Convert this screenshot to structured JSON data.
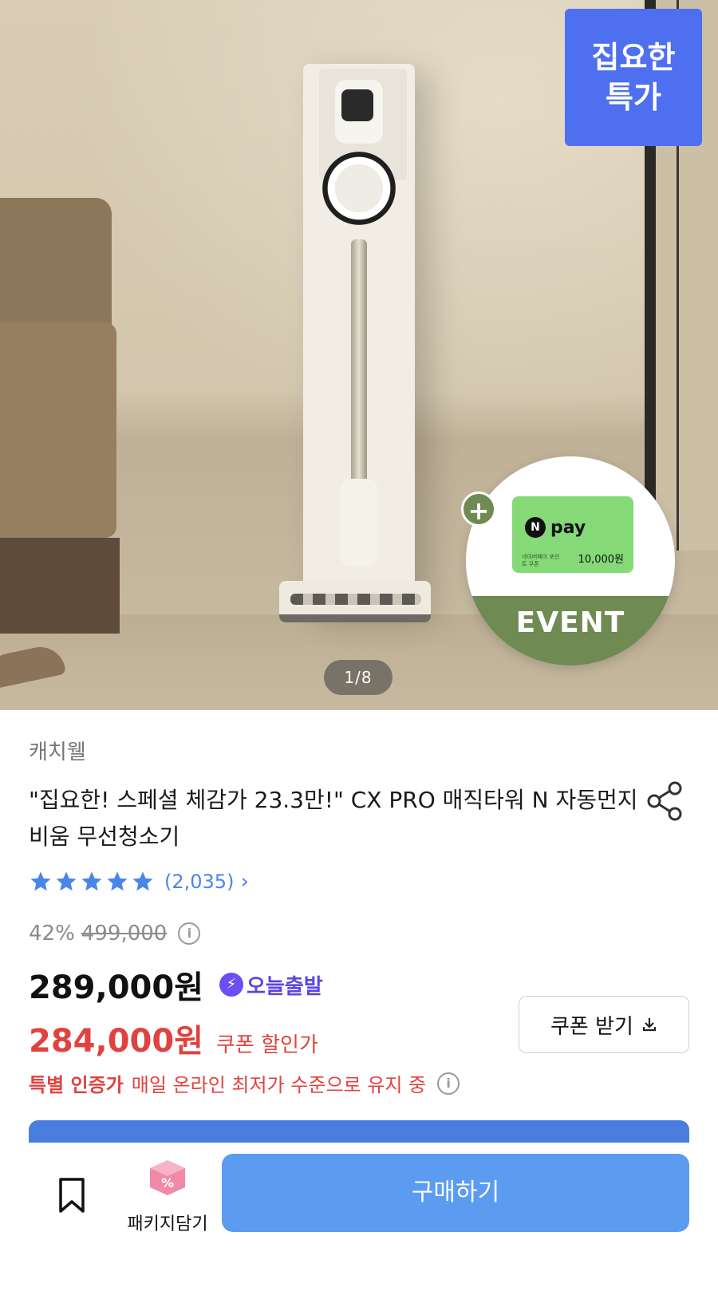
{
  "hero": {
    "deal_badge_line1": "집요한",
    "deal_badge_line2": "특가",
    "event_plus": "+",
    "npay_logo": "N",
    "npay_word": "pay",
    "npay_small": "네이버페이 포인트 쿠폰",
    "npay_amount": "10,000원",
    "event_label": "EVENT",
    "page_counter": "1/8"
  },
  "product": {
    "brand": "캐치웰",
    "title": "\"집요한! 스페셜 체감가 23.3만!\" CX PRO 매직타워 N 자동먼지비움 무선청소기",
    "rating_stars": 5,
    "rating_count": "(2,035)",
    "rating_arrow": "›",
    "discount_rate": "42%",
    "original_price": "499,000",
    "price": "289,000원",
    "delivery_icon": "⚡",
    "delivery_label": "오늘출발",
    "coupon_price": "284,000원",
    "coupon_label": "쿠폰 할인가",
    "coupon_button": "쿠폰 받기",
    "cert_strong": "특별 인증가",
    "cert_text": "매일 온라인 최저가 수준으로 유지 중",
    "info_glyph": "i"
  },
  "bottom_bar": {
    "package_label": "패키지담기",
    "buy_label": "구매하기"
  },
  "colors": {
    "deal_badge": "#4e6ff0",
    "event_green": "#6f8a52",
    "star_blue": "#4a86e8",
    "coupon_red": "#e0433f",
    "delivery_purple": "#5b45e6",
    "buy_button": "#5b9bf0"
  },
  "icons": [
    "share-icon",
    "star-icon",
    "chevron-right-icon",
    "info-icon",
    "bolt-icon",
    "download-icon",
    "bookmark-icon",
    "package-box-icon"
  ]
}
